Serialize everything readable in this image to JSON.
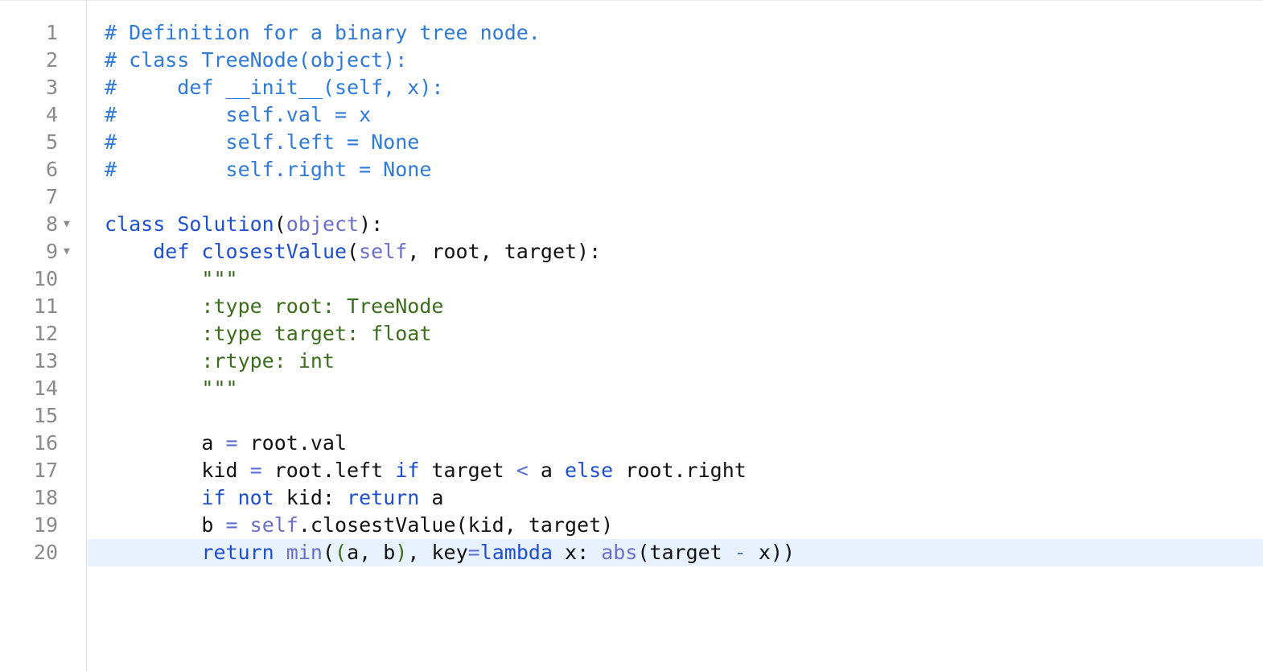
{
  "editor": {
    "active_line": 20,
    "colors": {
      "comment": "#2f7ad9",
      "keyword": "#1f4fd1",
      "builtin": "#6a6fc9",
      "string": "#3b6d1d",
      "plain": "#111111",
      "line_number": "#8a8a8a",
      "active_line_bg": "#e8f2fe"
    },
    "lines": [
      {
        "number": "1",
        "fold": "",
        "tokens": [
          {
            "t": "comment",
            "v": "# Definition for a binary tree node."
          }
        ]
      },
      {
        "number": "2",
        "fold": "",
        "tokens": [
          {
            "t": "comment",
            "v": "# class TreeNode(object):"
          }
        ]
      },
      {
        "number": "3",
        "fold": "",
        "tokens": [
          {
            "t": "comment",
            "v": "#     def __init__(self, x):"
          }
        ]
      },
      {
        "number": "4",
        "fold": "",
        "tokens": [
          {
            "t": "comment",
            "v": "#         self.val = x"
          }
        ]
      },
      {
        "number": "5",
        "fold": "",
        "tokens": [
          {
            "t": "comment",
            "v": "#         self.left = None"
          }
        ]
      },
      {
        "number": "6",
        "fold": "",
        "tokens": [
          {
            "t": "comment",
            "v": "#         self.right = None"
          }
        ]
      },
      {
        "number": "7",
        "fold": "",
        "tokens": []
      },
      {
        "number": "8",
        "fold": "▼",
        "tokens": [
          {
            "t": "kw",
            "v": "class "
          },
          {
            "t": "def",
            "v": "Solution"
          },
          {
            "t": "plain",
            "v": "("
          },
          {
            "t": "builtin",
            "v": "object"
          },
          {
            "t": "plain",
            "v": "):"
          }
        ]
      },
      {
        "number": "9",
        "fold": "▼",
        "tokens": [
          {
            "t": "plain",
            "v": "    "
          },
          {
            "t": "kw",
            "v": "def "
          },
          {
            "t": "def",
            "v": "closestValue"
          },
          {
            "t": "plain",
            "v": "("
          },
          {
            "t": "builtin",
            "v": "self"
          },
          {
            "t": "plain",
            "v": ", root, target):"
          }
        ]
      },
      {
        "number": "10",
        "fold": "",
        "tokens": [
          {
            "t": "plain",
            "v": "        "
          },
          {
            "t": "str",
            "v": "\"\"\""
          }
        ]
      },
      {
        "number": "11",
        "fold": "",
        "tokens": [
          {
            "t": "plain",
            "v": "        "
          },
          {
            "t": "str",
            "v": ":type root: TreeNode"
          }
        ]
      },
      {
        "number": "12",
        "fold": "",
        "tokens": [
          {
            "t": "plain",
            "v": "        "
          },
          {
            "t": "str",
            "v": ":type target: float"
          }
        ]
      },
      {
        "number": "13",
        "fold": "",
        "tokens": [
          {
            "t": "plain",
            "v": "        "
          },
          {
            "t": "str",
            "v": ":rtype: int"
          }
        ]
      },
      {
        "number": "14",
        "fold": "",
        "tokens": [
          {
            "t": "plain",
            "v": "        "
          },
          {
            "t": "str",
            "v": "\"\"\""
          }
        ]
      },
      {
        "number": "15",
        "fold": "",
        "tokens": []
      },
      {
        "number": "16",
        "fold": "",
        "tokens": [
          {
            "t": "plain",
            "v": "        a "
          },
          {
            "t": "op",
            "v": "="
          },
          {
            "t": "plain",
            "v": " root.val"
          }
        ]
      },
      {
        "number": "17",
        "fold": "",
        "tokens": [
          {
            "t": "plain",
            "v": "        kid "
          },
          {
            "t": "op",
            "v": "="
          },
          {
            "t": "plain",
            "v": " root.left "
          },
          {
            "t": "kw",
            "v": "if"
          },
          {
            "t": "plain",
            "v": " target "
          },
          {
            "t": "op",
            "v": "<"
          },
          {
            "t": "plain",
            "v": " a "
          },
          {
            "t": "kw",
            "v": "else"
          },
          {
            "t": "plain",
            "v": " root.right"
          }
        ]
      },
      {
        "number": "18",
        "fold": "",
        "tokens": [
          {
            "t": "plain",
            "v": "        "
          },
          {
            "t": "kw",
            "v": "if not"
          },
          {
            "t": "plain",
            "v": " kid: "
          },
          {
            "t": "kw",
            "v": "return"
          },
          {
            "t": "plain",
            "v": " a"
          }
        ]
      },
      {
        "number": "19",
        "fold": "",
        "tokens": [
          {
            "t": "plain",
            "v": "        b "
          },
          {
            "t": "op",
            "v": "="
          },
          {
            "t": "plain",
            "v": " "
          },
          {
            "t": "builtin",
            "v": "self"
          },
          {
            "t": "plain",
            "v": ".closestValue(kid, target)"
          }
        ]
      },
      {
        "number": "20",
        "fold": "",
        "tokens": [
          {
            "t": "plain",
            "v": "        "
          },
          {
            "t": "kw",
            "v": "return"
          },
          {
            "t": "plain",
            "v": " "
          },
          {
            "t": "builtin",
            "v": "min"
          },
          {
            "t": "plain",
            "v": "("
          },
          {
            "t": "str",
            "v": "("
          },
          {
            "t": "plain",
            "v": "a, b"
          },
          {
            "t": "str",
            "v": ")"
          },
          {
            "t": "plain",
            "v": ", key"
          },
          {
            "t": "op",
            "v": "="
          },
          {
            "t": "kw",
            "v": "lambda"
          },
          {
            "t": "plain",
            "v": " x: "
          },
          {
            "t": "builtin",
            "v": "abs"
          },
          {
            "t": "plain",
            "v": "(target "
          },
          {
            "t": "op",
            "v": "-"
          },
          {
            "t": "plain",
            "v": " x))"
          }
        ]
      }
    ]
  }
}
